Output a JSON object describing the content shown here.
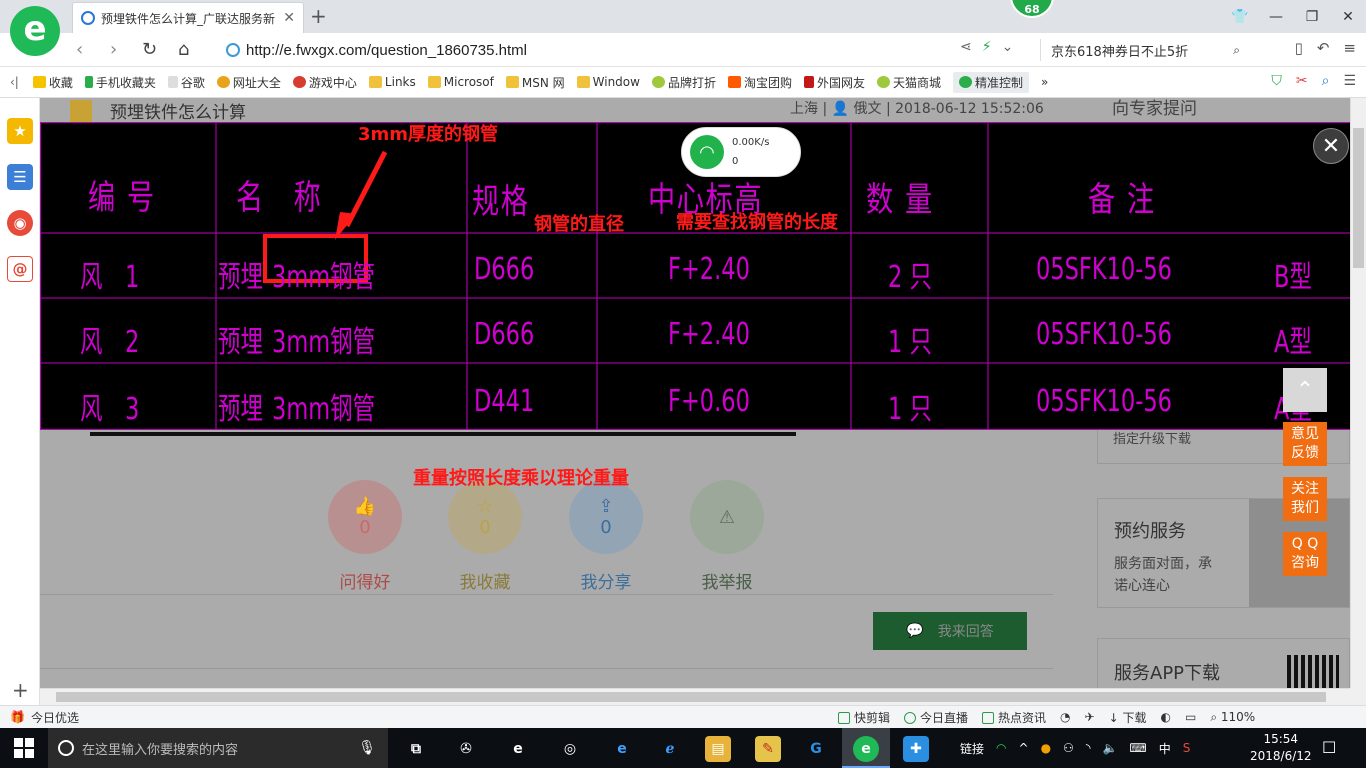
{
  "browser": {
    "tab_title": "预埋铁件怎么计算_广联达服务新",
    "tab_close": "✕",
    "new_tab": "+",
    "badge_count": "68",
    "url": "http://e.fwxgx.com/question_1860735.html",
    "search_text": "京东618神券日不止5折",
    "back": "‹",
    "forward": "›",
    "reload": "↻",
    "home": "⌂"
  },
  "bookmarks": [
    {
      "label": "收藏",
      "icon": "star-icon"
    },
    {
      "label": "手机收藏夹",
      "icon": "phone-icon"
    },
    {
      "label": "谷歌",
      "icon": "page-icon"
    },
    {
      "label": "网址大全",
      "icon": "globe-icon"
    },
    {
      "label": "游戏中心",
      "icon": "game-icon"
    },
    {
      "label": "Links",
      "icon": "folder-icon"
    },
    {
      "label": "Microsof",
      "icon": "folder-icon"
    },
    {
      "label": "MSN 网",
      "icon": "folder-icon"
    },
    {
      "label": "Window",
      "icon": "folder-icon"
    },
    {
      "label": "品牌打折",
      "icon": "leaf-icon"
    },
    {
      "label": "淘宝团购",
      "icon": "taobao-icon"
    },
    {
      "label": "外国网友",
      "icon": "bookmark-icon"
    },
    {
      "label": "天猫商城",
      "icon": "leaf-icon"
    },
    {
      "label": "精准控制",
      "icon": "wechat-icon"
    }
  ],
  "bookmark_more": "»",
  "page": {
    "question_title": "预埋铁件怎么计算",
    "question_meta": "上海 | 👤 俄文 | 2018-06-12 15:52:06",
    "ask_expert": "向专家提问",
    "upgrade_note": "指定升级下载",
    "actions": [
      {
        "label": "问得好",
        "count": "0",
        "icon": "thumb-up-icon",
        "color": "#c96a6a"
      },
      {
        "label": "我收藏",
        "count": "0",
        "icon": "star-icon",
        "color": "#b9a247"
      },
      {
        "label": "我分享",
        "count": "0",
        "icon": "share-icon",
        "color": "#4c7fb0"
      },
      {
        "label": "我举报",
        "count": "",
        "icon": "warning-icon",
        "color": "#6f8a6a"
      }
    ],
    "answer_button": "我来回答",
    "booking_title": "预约服务",
    "booking_sub1": "服务面对面，承",
    "booking_sub2": "诺心连心",
    "app_title": "服务APP下载"
  },
  "image_table": {
    "headers": [
      "编 号",
      "名　称",
      "规格",
      "中心标高",
      "数 量",
      "备 注"
    ],
    "rows": [
      {
        "id": "风　1",
        "pre": "预埋",
        "name": "3mm钢管",
        "spec": "D666",
        "elev": "F+2.40",
        "qty": "2 只",
        "note": "05SFK10-56",
        "type": "B型"
      },
      {
        "id": "风　2",
        "pre": "预埋",
        "name": "3mm钢管",
        "spec": "D666",
        "elev": "F+2.40",
        "qty": "1 只",
        "note": "05SFK10-56",
        "type": "A型"
      },
      {
        "id": "风　3",
        "pre": "预埋",
        "name": "3mm钢管",
        "spec": "D441",
        "elev": "F+0.60",
        "qty": "1 只",
        "note": "05SFK10-56",
        "type": "A型"
      }
    ],
    "annotations": {
      "thickness": "3mm厚度的钢管",
      "diameter": "钢管的直径",
      "length": "需要查找钢管的长度"
    },
    "caption": "重量按照长度乘以理论重量",
    "close": "✕"
  },
  "wifi_popup": {
    "speed": "0.00K/s",
    "count": "0"
  },
  "float_buttons": {
    "to_top": "⌃",
    "feedback": [
      "意见",
      "反馈"
    ],
    "follow": [
      "关注",
      "我们"
    ],
    "qq": [
      "Q Q",
      "咨询"
    ]
  },
  "statusbar": {
    "left": "今日优选",
    "items": [
      "快剪辑",
      "今日直播",
      "热点资讯",
      "下载"
    ],
    "zoom": "110%"
  },
  "taskbar": {
    "search_placeholder": "在这里输入你要搜索的内容",
    "tray_link": "链接",
    "ime": "中",
    "time": "15:54",
    "date": "2018/6/12"
  },
  "colors": {
    "cad_magenta": "#d000d0",
    "annotation_red": "#ff1a1a",
    "orange": "#f06d12",
    "browser_green": "#20b957"
  }
}
